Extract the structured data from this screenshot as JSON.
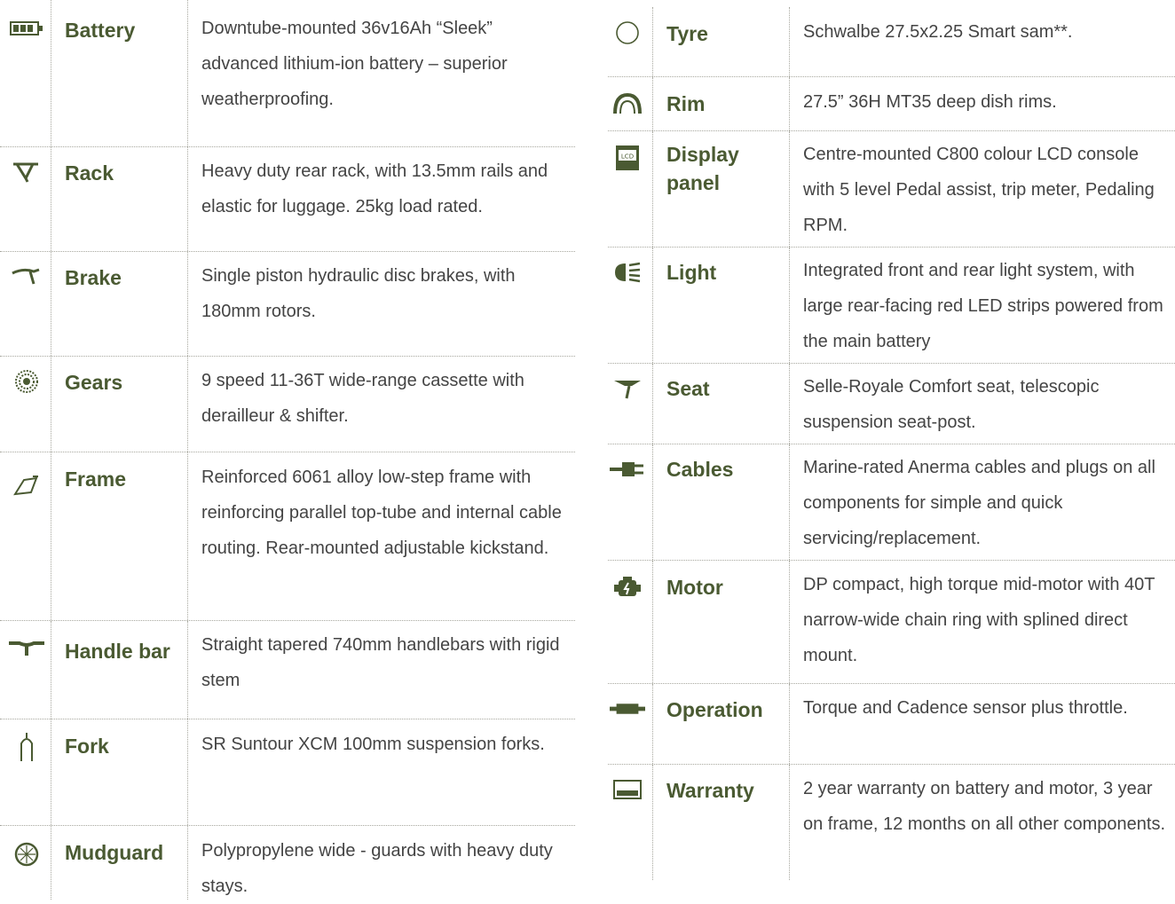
{
  "colors": {
    "accent": "#4a5a32",
    "text": "#444444",
    "divider": "#a7a79e"
  },
  "left": [
    {
      "icon": "battery-icon",
      "name": "Battery",
      "desc": "Downtube-mounted 36v16Ah “Sleek” advanced lithium-ion battery – superior weatherproofing."
    },
    {
      "icon": "rack-icon",
      "name": "Rack",
      "desc": "Heavy duty rear rack, with 13.5mm rails and elastic for luggage. 25kg load rated."
    },
    {
      "icon": "brake-icon",
      "name": "Brake",
      "desc": "Single piston hydraulic disc brakes, with 180mm rotors."
    },
    {
      "icon": "gears-icon",
      "name": "Gears",
      "desc": "9 speed 11-36T wide-range cassette with derailleur & shifter."
    },
    {
      "icon": "frame-icon",
      "name": "Frame",
      "desc": "Reinforced 6061 alloy low-step frame with reinforcing parallel top-tube and internal cable routing. Rear-mounted adjustable kickstand."
    },
    {
      "icon": "handlebar-icon",
      "name": "Handle bar",
      "desc": "Straight tapered 740mm handlebars with rigid stem"
    },
    {
      "icon": "fork-icon",
      "name": "Fork",
      "desc": "SR Suntour XCM 100mm suspension forks."
    },
    {
      "icon": "mudguard-icon",
      "name": "Mudguard",
      "desc": "Polypropylene wide - guards with heavy duty stays."
    }
  ],
  "right": [
    {
      "icon": "tyre-icon",
      "name": "Tyre",
      "desc": "Schwalbe 27.5x2.25 Smart sam**."
    },
    {
      "icon": "rim-icon",
      "name": "Rim",
      "desc": "27.5” 36H  MT35 deep dish rims."
    },
    {
      "icon": "display-panel-icon",
      "icon_text": "LCD",
      "name": "Display panel",
      "desc": "Centre-mounted C800 colour LCD console with 5 level Pedal assist, trip meter, Pedaling RPM."
    },
    {
      "icon": "light-icon",
      "name": "Light",
      "desc": "Integrated front and rear light system, with large rear-facing red LED strips powered from the main battery"
    },
    {
      "icon": "seat-icon",
      "name": "Seat",
      "desc": "Selle-Royale Comfort seat, telescopic suspension seat-post."
    },
    {
      "icon": "cables-icon",
      "name": "Cables",
      "desc": "Marine-rated Anerma cables and plugs on all components for simple and quick servicing/replacement."
    },
    {
      "icon": "motor-icon",
      "name": "Motor",
      "desc": "DP compact, high torque mid-motor with 40T narrow-wide chain ring with splined direct mount."
    },
    {
      "icon": "operation-icon",
      "name": "Operation",
      "desc": "Torque and Cadence sensor plus throttle."
    },
    {
      "icon": "warranty-icon",
      "name": "Warranty",
      "desc": "2 year warranty on battery and motor, 3 year on frame, 12 months on all other components."
    }
  ]
}
